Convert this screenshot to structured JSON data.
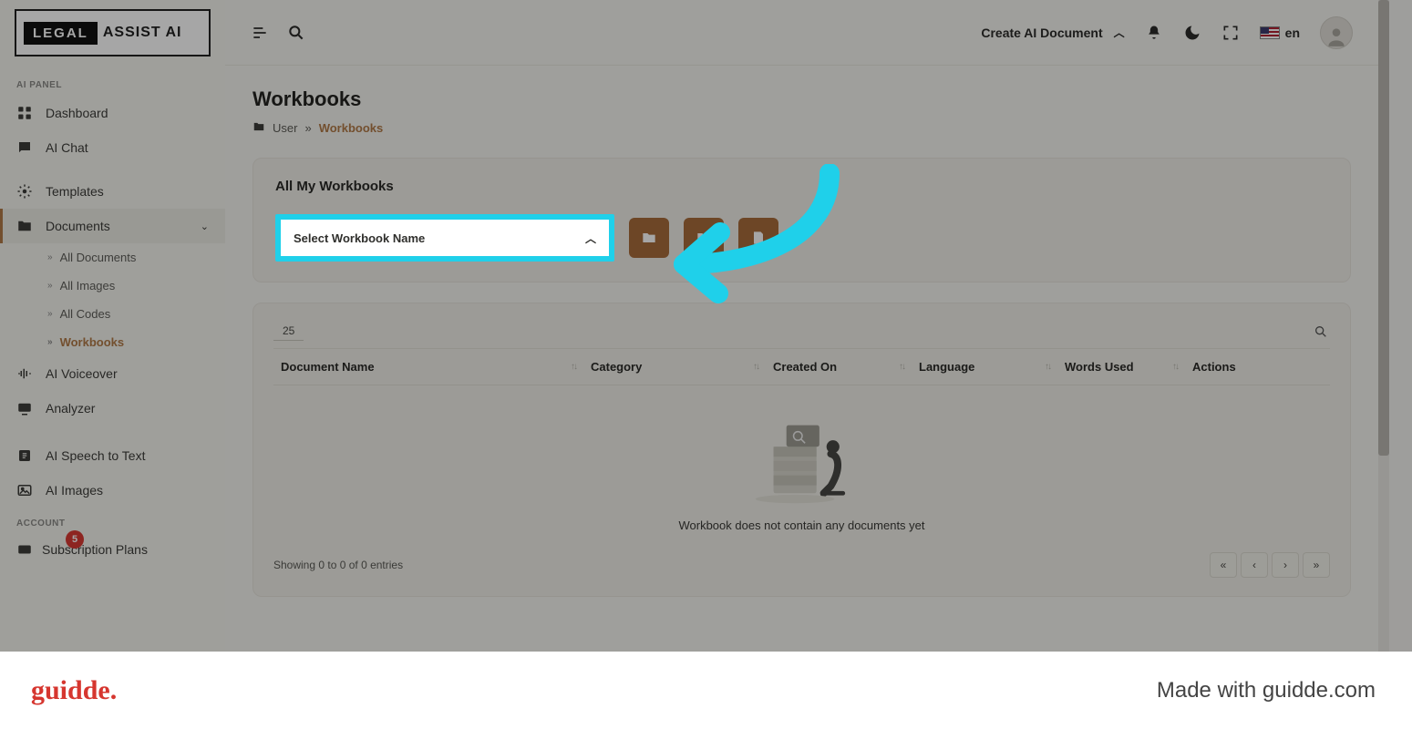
{
  "brand": {
    "left": "LEGAL",
    "right": "ASSIST AI"
  },
  "sidebar": {
    "section_ai": "AI PANEL",
    "section_account": "ACCOUNT",
    "items": {
      "dashboard": "Dashboard",
      "ai_chat": "AI Chat",
      "templates": "Templates",
      "documents": "Documents",
      "ai_voiceover": "AI Voiceover",
      "analyzer": "Analyzer",
      "ai_speech": "AI Speech to Text",
      "ai_images": "AI Images",
      "subscription": "Subscription Plans"
    },
    "documents_sub": {
      "all_documents": "All Documents",
      "all_images": "All Images",
      "all_codes": "All Codes",
      "workbooks": "Workbooks"
    },
    "badge_count": "5"
  },
  "topbar": {
    "create_doc": "Create AI Document",
    "lang_code": "en"
  },
  "page": {
    "title": "Workbooks",
    "crumb_user": "User",
    "crumb_sep": "»",
    "crumb_current": "Workbooks"
  },
  "workbooks_card": {
    "title": "All My Workbooks",
    "select_placeholder": "Select Workbook Name"
  },
  "table": {
    "page_size": "25",
    "columns": {
      "doc_name": "Document Name",
      "category": "Category",
      "created_on": "Created On",
      "language": "Language",
      "words_used": "Words Used",
      "actions": "Actions"
    },
    "empty_message": "Workbook does not contain any documents yet",
    "showing_text": "Showing 0 to 0 of 0 entries"
  },
  "guidde": {
    "logo": "guidde.",
    "made_with": "Made with guidde.com"
  }
}
